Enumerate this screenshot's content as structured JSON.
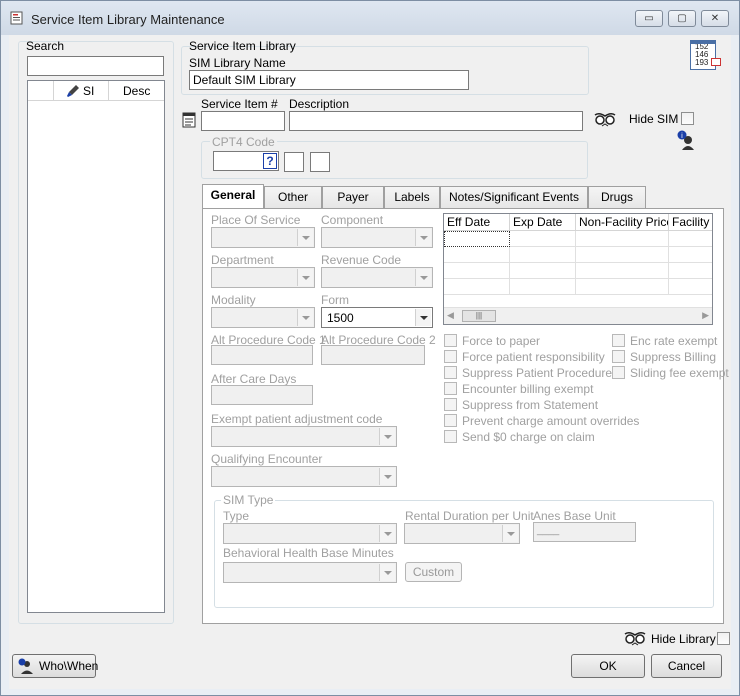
{
  "window": {
    "title": "Service Item Library Maintenance",
    "controls": {
      "minimize": "▭",
      "maximize": "▢",
      "close": "✕"
    }
  },
  "left_panel": {
    "search_label": "Search",
    "search_value": "",
    "list_headers": [
      "SI",
      "Desc"
    ]
  },
  "library": {
    "group_label": "Service Item Library",
    "name_label": "SIM Library Name",
    "name_value": "Default SIM Library"
  },
  "item": {
    "number_label": "Service Item #",
    "number_value": "",
    "desc_label": "Description",
    "desc_value": "",
    "hide_sim_label": "Hide SIM",
    "cpt_label": "CPT4 Code",
    "cpt_help": "?"
  },
  "calendar_icon": {
    "lines": [
      "152",
      "146",
      "193"
    ]
  },
  "tabs": [
    {
      "label": "General"
    },
    {
      "label": "Other"
    },
    {
      "label": "Payer"
    },
    {
      "label": "Labels"
    },
    {
      "label": "Notes/Significant Events"
    },
    {
      "label": "Drugs"
    }
  ],
  "general": {
    "place_of_service": "Place Of Service",
    "component": "Component",
    "department": "Department",
    "revenue_code": "Revenue Code",
    "modality": "Modality",
    "form": "Form",
    "form_value": "1500",
    "alt_proc_1": "Alt Procedure Code 1",
    "alt_proc_2": "Alt Procedure Code 2",
    "after_care_days": "After Care Days",
    "exempt_adj": "Exempt patient adjustment code",
    "qualifying_encounter": "Qualifying Encounter"
  },
  "price_grid": {
    "headers": [
      "Eff Date",
      "Exp Date",
      "Non-Facility Price",
      "Facility P"
    ],
    "scroll_thumb": "|||"
  },
  "checkboxes_left": [
    "Force to paper",
    "Force patient responsibility",
    "Suppress Patient Procedure",
    "Encounter billing exempt",
    "Suppress from Statement",
    "Prevent charge amount overrides",
    "Send $0 charge on claim"
  ],
  "checkboxes_right": [
    "Enc rate exempt",
    "Suppress Billing",
    "Sliding fee exempt"
  ],
  "sim_type": {
    "group_label": "SIM Type",
    "type_label": "Type",
    "rental_label": "Rental Duration per Unit",
    "anes_label": "Anes Base Unit",
    "anes_value": "____",
    "behavioral_label": "Behavioral Health Base Minutes",
    "custom_button": "Custom"
  },
  "footer": {
    "hide_library_label": "Hide Library",
    "who_when_button": "Who\\When",
    "ok_button": "OK",
    "cancel_button": "Cancel"
  },
  "colors": {
    "window_bg": "#f0f0f0",
    "titlebar": "#dfe7f1",
    "help_blue": "#1a3fa8"
  },
  "icons": [
    "app-icon",
    "glasses-icon",
    "info-person-icon",
    "calendar-icon",
    "notes-icon",
    "brush-icon"
  ]
}
